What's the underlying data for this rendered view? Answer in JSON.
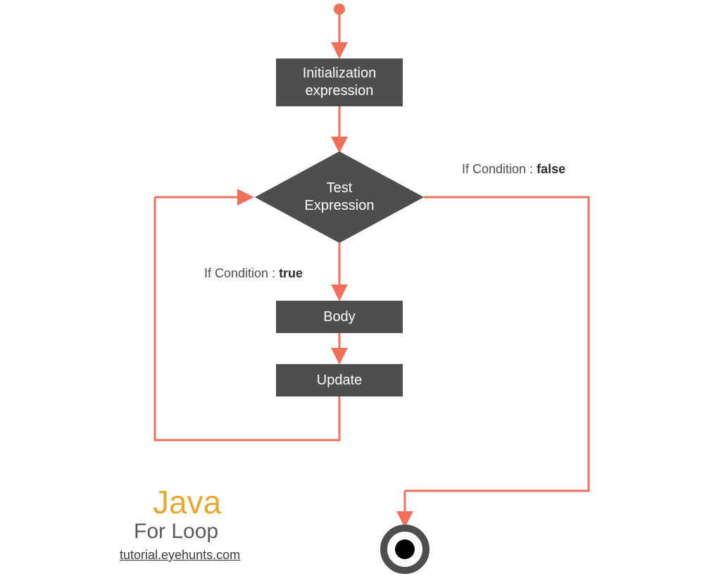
{
  "nodes": {
    "init": "Initialization\nexpression",
    "test": "Test\nExpression",
    "body": "Body",
    "update": "Update"
  },
  "annotations": {
    "false_prefix": "If Condition : ",
    "false_value": "false",
    "true_prefix": "If Condition : ",
    "true_value": "true"
  },
  "title": {
    "java": "Java",
    "sub": "For Loop",
    "link": "tutorial.eyehunts.com"
  },
  "colors": {
    "arrow": "#f0705a",
    "node": "#4e4e4e",
    "java": "#e7a92f"
  }
}
